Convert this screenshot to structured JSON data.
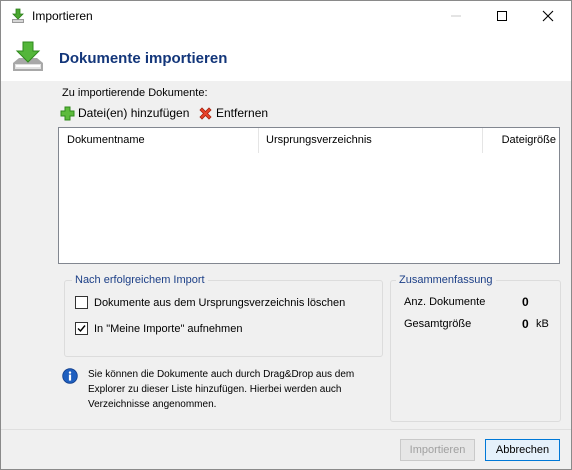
{
  "window": {
    "title": "Importieren",
    "icon": "download-icon"
  },
  "header": {
    "title": "Dokumente importieren",
    "icon": "document-import-icon"
  },
  "documents": {
    "label": "Zu importierende Dokumente:",
    "add_label": "Datei(en) hinzufügen",
    "remove_label": "Entfernen",
    "columns": [
      "Dokumentname",
      "Ursprungsverzeichnis",
      "Dateigröße"
    ],
    "rows": []
  },
  "after_import": {
    "caption": "Nach erfolgreichem Import",
    "options": [
      {
        "label": "Dokumente aus dem Ursprungsverzeichnis löschen",
        "checked": false
      },
      {
        "label": "In \"Meine Importe\" aufnehmen",
        "checked": true
      }
    ]
  },
  "summary": {
    "caption": "Zusammenfassung",
    "count_label": "Anz. Dokumente",
    "count_value": "0",
    "size_label": "Gesamtgröße",
    "size_value": "0",
    "size_unit": "kB"
  },
  "info": {
    "icon": "info-icon",
    "text": "Sie können die Dokumente auch durch Drag&Drop aus dem Explorer zu dieser Liste hinzufügen. Hierbei werden auch Verzeichnisse angenommen."
  },
  "buttons": {
    "import": "Importieren",
    "cancel": "Abbrechen"
  }
}
